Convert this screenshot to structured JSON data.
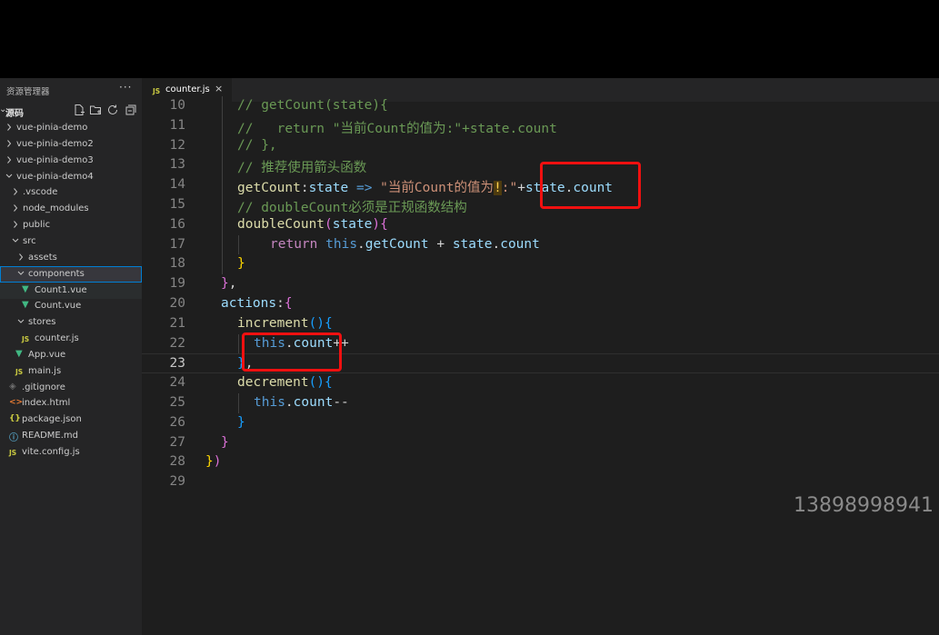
{
  "sidebar": {
    "title": "资源管理器",
    "more": "···",
    "section_title": "源码",
    "tree": [
      {
        "label": "vue-pinia-demo",
        "depth": 0,
        "kind": "folder",
        "open": false
      },
      {
        "label": "vue-pinia-demo2",
        "depth": 0,
        "kind": "folder",
        "open": false
      },
      {
        "label": "vue-pinia-demo3",
        "depth": 0,
        "kind": "folder",
        "open": false
      },
      {
        "label": "vue-pinia-demo4",
        "depth": 0,
        "kind": "folder",
        "open": true
      },
      {
        "label": ".vscode",
        "depth": 1,
        "kind": "folder",
        "open": false
      },
      {
        "label": "node_modules",
        "depth": 1,
        "kind": "folder",
        "open": false
      },
      {
        "label": "public",
        "depth": 1,
        "kind": "folder",
        "open": false
      },
      {
        "label": "src",
        "depth": 1,
        "kind": "folder",
        "open": true
      },
      {
        "label": "assets",
        "depth": 2,
        "kind": "folder",
        "open": false
      },
      {
        "label": "components",
        "depth": 2,
        "kind": "folder",
        "open": true
      },
      {
        "label": "Count1.vue",
        "depth": 3,
        "kind": "vue"
      },
      {
        "label": "Count.vue",
        "depth": 3,
        "kind": "vue"
      },
      {
        "label": "stores",
        "depth": 2,
        "kind": "folder",
        "open": true
      },
      {
        "label": "counter.js",
        "depth": 3,
        "kind": "js"
      },
      {
        "label": "App.vue",
        "depth": 2,
        "kind": "vue"
      },
      {
        "label": "main.js",
        "depth": 2,
        "kind": "js"
      },
      {
        "label": ".gitignore",
        "depth": 1,
        "kind": "git"
      },
      {
        "label": "index.html",
        "depth": 1,
        "kind": "html"
      },
      {
        "label": "package.json",
        "depth": 1,
        "kind": "json"
      },
      {
        "label": "README.md",
        "depth": 1,
        "kind": "info"
      },
      {
        "label": "vite.config.js",
        "depth": 1,
        "kind": "js"
      }
    ]
  },
  "editor": {
    "tab": {
      "icon": "JS",
      "label": "counter.js",
      "close": "×"
    },
    "active_line": "23",
    "lines": [
      {
        "n": "10",
        "tokens": [
          [
            "c",
            "// getCount(state){"
          ]
        ]
      },
      {
        "n": "11",
        "tokens": [
          [
            "c",
            "//   return \"当前Count的值为:\"+state.count"
          ]
        ]
      },
      {
        "n": "12",
        "tokens": [
          [
            "c",
            "// },"
          ]
        ]
      },
      {
        "n": "13",
        "tokens": [
          [
            "c",
            "// 推荐使用箭头函数"
          ]
        ]
      },
      {
        "n": "14",
        "tokens": [
          [
            "f",
            "getCount"
          ],
          [
            "o",
            ":"
          ],
          [
            "v",
            "state"
          ],
          [
            "o",
            " "
          ],
          [
            "t",
            "=>"
          ],
          [
            "o",
            " "
          ],
          [
            "s",
            "\"当前Count的值为"
          ],
          [
            "warn",
            "!"
          ],
          [
            "s",
            ":\""
          ],
          [
            "o",
            "+"
          ],
          [
            "v",
            "state"
          ],
          [
            "o",
            "."
          ],
          [
            "v",
            "count"
          ]
        ]
      },
      {
        "n": "15",
        "tokens": [
          [
            "c",
            "// doubleCount必须是正规函数结构"
          ]
        ]
      },
      {
        "n": "16",
        "tokens": [
          [
            "f",
            "doubleCount"
          ],
          [
            "b2",
            "("
          ],
          [
            "v",
            "state"
          ],
          [
            "b2",
            ")"
          ],
          [
            "b2",
            "{"
          ]
        ]
      },
      {
        "n": "17",
        "tokens": [
          [
            "k",
            "return"
          ],
          [
            "o",
            " "
          ],
          [
            "t",
            "this"
          ],
          [
            "o",
            "."
          ],
          [
            "v",
            "getCount"
          ],
          [
            "o",
            " + "
          ],
          [
            "v",
            "state"
          ],
          [
            "o",
            "."
          ],
          [
            "v",
            "count"
          ]
        ]
      },
      {
        "n": "18",
        "tokens": [
          [
            "b1",
            "}"
          ]
        ]
      },
      {
        "n": "19",
        "tokens": [
          [
            "b2",
            "}"
          ],
          [
            "o",
            ","
          ]
        ]
      },
      {
        "n": "20",
        "tokens": [
          [
            "v",
            "actions"
          ],
          [
            "o",
            ":"
          ],
          [
            "b2",
            "{"
          ]
        ]
      },
      {
        "n": "21",
        "tokens": [
          [
            "f",
            "increment"
          ],
          [
            "b3",
            "()"
          ],
          [
            "b3",
            "{"
          ]
        ]
      },
      {
        "n": "22",
        "tokens": [
          [
            "t",
            "this"
          ],
          [
            "o",
            "."
          ],
          [
            "v",
            "count"
          ],
          [
            "o",
            "++"
          ]
        ]
      },
      {
        "n": "23",
        "tokens": [
          [
            "b3",
            "}"
          ],
          [
            "o",
            ","
          ]
        ]
      },
      {
        "n": "24",
        "tokens": [
          [
            "f",
            "decrement"
          ],
          [
            "b3",
            "()"
          ],
          [
            "b3",
            "{"
          ]
        ]
      },
      {
        "n": "25",
        "tokens": [
          [
            "t",
            "this"
          ],
          [
            "o",
            "."
          ],
          [
            "v",
            "count"
          ],
          [
            "o",
            "--"
          ]
        ]
      },
      {
        "n": "26",
        "tokens": [
          [
            "b3",
            "}"
          ]
        ]
      },
      {
        "n": "27",
        "tokens": [
          [
            "b2",
            "}"
          ]
        ]
      },
      {
        "n": "28",
        "tokens": [
          [
            "b1",
            "}"
          ],
          [
            "b2",
            ")"
          ]
        ]
      },
      {
        "n": "29",
        "tokens": []
      }
    ]
  },
  "watermark": "13898998941",
  "colors": {
    "highlight_box": "#f01010",
    "accent": "#007fd4"
  }
}
